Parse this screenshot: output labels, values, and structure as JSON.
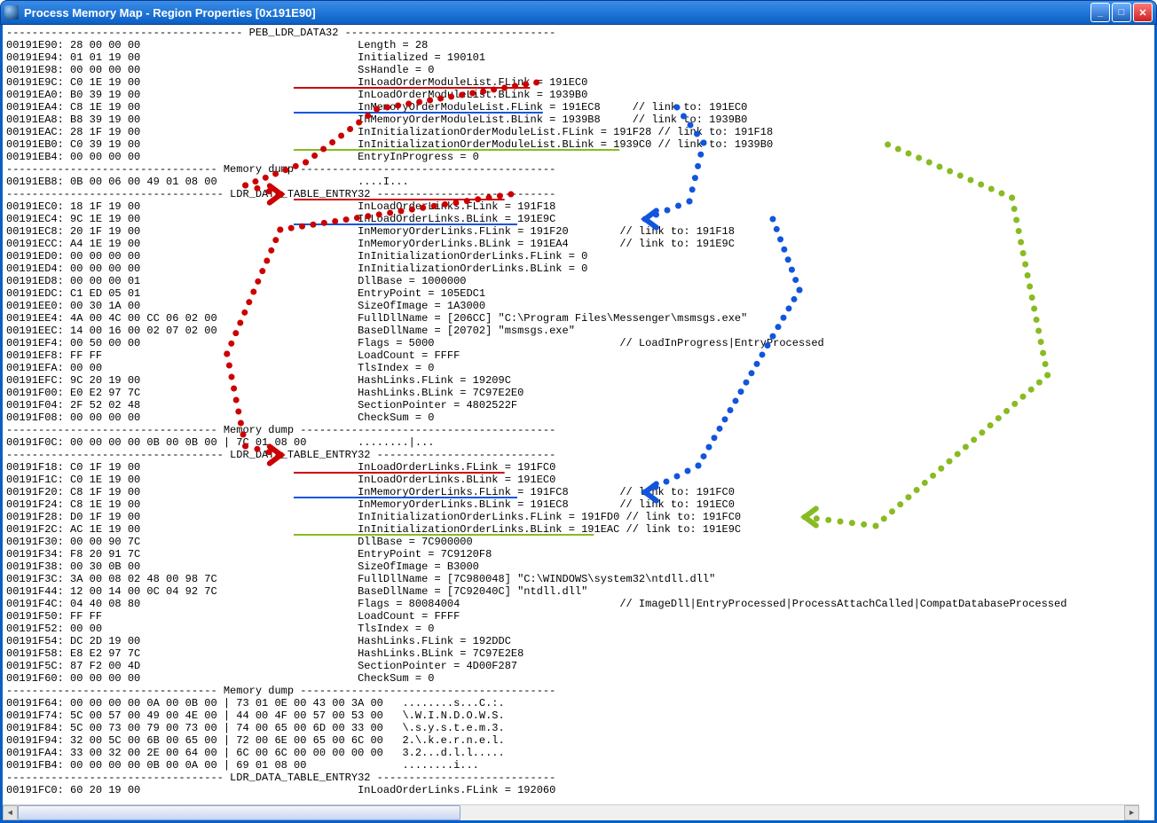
{
  "window": {
    "title": "Process Memory Map - Region Properties [0x191E90]"
  },
  "hex_block": "------------------------------------- PEB_LDR_DATA32 ---------------------------------\n00191E90: 28 00 00 00                                  Length = 28\n00191E94: 01 01 19 00                                  Initialized = 190101\n00191E98: 00 00 00 00                                  SsHandle = 0\n00191E9C: C0 1E 19 00                                  InLoadOrderModuleList.FLink = 191EC0\n00191EA0: B0 39 19 00                                  InLoadOrderModuleList.BLink = 1939B0\n00191EA4: C8 1E 19 00                                  InMemoryOrderModuleList.FLink = 191EC8     // link to: 191EC0\n00191EA8: B8 39 19 00                                  InMemoryOrderModuleList.BLink = 1939B8     // link to: 1939B0\n00191EAC: 28 1F 19 00                                  InInitializationOrderModuleList.FLink = 191F28 // link to: 191F18\n00191EB0: C0 39 19 00                                  InInitializationOrderModuleList.BLink = 1939C0 // link to: 1939B0\n00191EB4: 00 00 00 00                                  EntryInProgress = 0\n--------------------------------- Memory dump ----------------------------------------\n00191EB8: 0B 00 06 00 49 01 08 00                      ....I...\n---------------------------------- LDR_DATA_TABLE_ENTRY32 ----------------------------\n00191EC0: 18 1F 19 00                                  InLoadOrderLinks.FLink = 191F18\n00191EC4: 9C 1E 19 00                                  InLoadOrderLinks.BLink = 191E9C\n00191EC8: 20 1F 19 00                                  InMemoryOrderLinks.FLink = 191F20        // link to: 191F18\n00191ECC: A4 1E 19 00                                  InMemoryOrderLinks.BLink = 191EA4        // link to: 191E9C\n00191ED0: 00 00 00 00                                  InInitializationOrderLinks.FLink = 0\n00191ED4: 00 00 00 00                                  InInitializationOrderLinks.BLink = 0\n00191ED8: 00 00 00 01                                  DllBase = 1000000\n00191EDC: C1 ED 05 01                                  EntryPoint = 105EDC1\n00191EE0: 00 30 1A 00                                  SizeOfImage = 1A3000\n00191EE4: 4A 00 4C 00 CC 06 02 00                      FullDllName = [206CC] \"C:\\Program Files\\Messenger\\msmsgs.exe\"\n00191EEC: 14 00 16 00 02 07 02 00                      BaseDllName = [20702] \"msmsgs.exe\"\n00191EF4: 00 50 00 00                                  Flags = 5000                             // LoadInProgress|EntryProcessed\n00191EF8: FF FF                                        LoadCount = FFFF\n00191EFA: 00 00                                        TlsIndex = 0\n00191EFC: 9C 20 19 00                                  HashLinks.FLink = 19209C\n00191F00: E0 E2 97 7C                                  HashLinks.BLink = 7C97E2E0\n00191F04: 2F 52 02 48                                  SectionPointer = 4802522F\n00191F08: 00 00 00 00                                  CheckSum = 0\n--------------------------------- Memory dump ----------------------------------------\n00191F0C: 00 00 00 00 0B 00 0B 00 | 7C 01 08 00        ........|...\n---------------------------------- LDR_DATA_TABLE_ENTRY32 ----------------------------\n00191F18: C0 1F 19 00                                  InLoadOrderLinks.FLink = 191FC0\n00191F1C: C0 1E 19 00                                  InLoadOrderLinks.BLink = 191EC0\n00191F20: C8 1F 19 00                                  InMemoryOrderLinks.FLink = 191FC8        // link to: 191FC0\n00191F24: C8 1E 19 00                                  InMemoryOrderLinks.BLink = 191EC8        // link to: 191EC0\n00191F28: D0 1F 19 00                                  InInitializationOrderLinks.FLink = 191FD0 // link to: 191FC0\n00191F2C: AC 1E 19 00                                  InInitializationOrderLinks.BLink = 191EAC // link to: 191E9C\n00191F30: 00 00 90 7C                                  DllBase = 7C900000\n00191F34: F8 20 91 7C                                  EntryPoint = 7C9120F8\n00191F38: 00 30 0B 00                                  SizeOfImage = B3000\n00191F3C: 3A 00 08 02 48 00 98 7C                      FullDllName = [7C980048] \"C:\\WINDOWS\\system32\\ntdll.dll\"\n00191F44: 12 00 14 00 0C 04 92 7C                      BaseDllName = [7C92040C] \"ntdll.dll\"\n00191F4C: 04 40 08 80                                  Flags = 80084004                         // ImageDll|EntryProcessed|ProcessAttachCalled|CompatDatabaseProcessed\n00191F50: FF FF                                        LoadCount = FFFF\n00191F52: 00 00                                        TlsIndex = 0\n00191F54: DC 2D 19 00                                  HashLinks.FLink = 192DDC\n00191F58: E8 E2 97 7C                                  HashLinks.BLink = 7C97E2E8\n00191F5C: 87 F2 00 4D                                  SectionPointer = 4D00F287\n00191F60: 00 00 00 00                                  CheckSum = 0\n--------------------------------- Memory dump ----------------------------------------\n00191F64: 00 00 00 00 0A 00 0B 00 | 73 01 0E 00 43 00 3A 00   ........s...C.:.\n00191F74: 5C 00 57 00 49 00 4E 00 | 44 00 4F 00 57 00 53 00   \\.W.I.N.D.O.W.S.\n00191F84: 5C 00 73 00 79 00 73 00 | 74 00 65 00 6D 00 33 00   \\.s.y.s.t.e.m.3.\n00191F94: 32 00 5C 00 6B 00 65 00 | 72 00 6E 00 65 00 6C 00   2.\\.k.e.r.n.e.l.\n00191FA4: 33 00 32 00 2E 00 64 00 | 6C 00 6C 00 00 00 00 00   3.2...d.l.l.....\n00191FB4: 00 00 00 00 0B 00 0A 00 | 69 01 08 00               ........i...\n---------------------------------- LDR_DATA_TABLE_ENTRY32 ----------------------------\n00191FC0: 60 20 19 00                                  InLoadOrderLinks.FLink = 192060",
  "underlines": {
    "red": [
      {
        "row": 4,
        "col": 45,
        "len": 37
      },
      {
        "row": 13,
        "col": 45,
        "len": 33
      },
      {
        "row": 35,
        "col": 45,
        "len": 33
      }
    ],
    "blue": [
      {
        "row": 6,
        "col": 45,
        "len": 39
      },
      {
        "row": 15,
        "col": 45,
        "len": 35
      },
      {
        "row": 37,
        "col": 45,
        "len": 35
      }
    ],
    "green": [
      {
        "row": 9,
        "col": 45,
        "len": 51
      },
      {
        "row": 40,
        "col": 45,
        "len": 47
      }
    ]
  },
  "colors": {
    "red": "#cc0000",
    "blue": "#1155dd",
    "green": "#88bb22"
  }
}
